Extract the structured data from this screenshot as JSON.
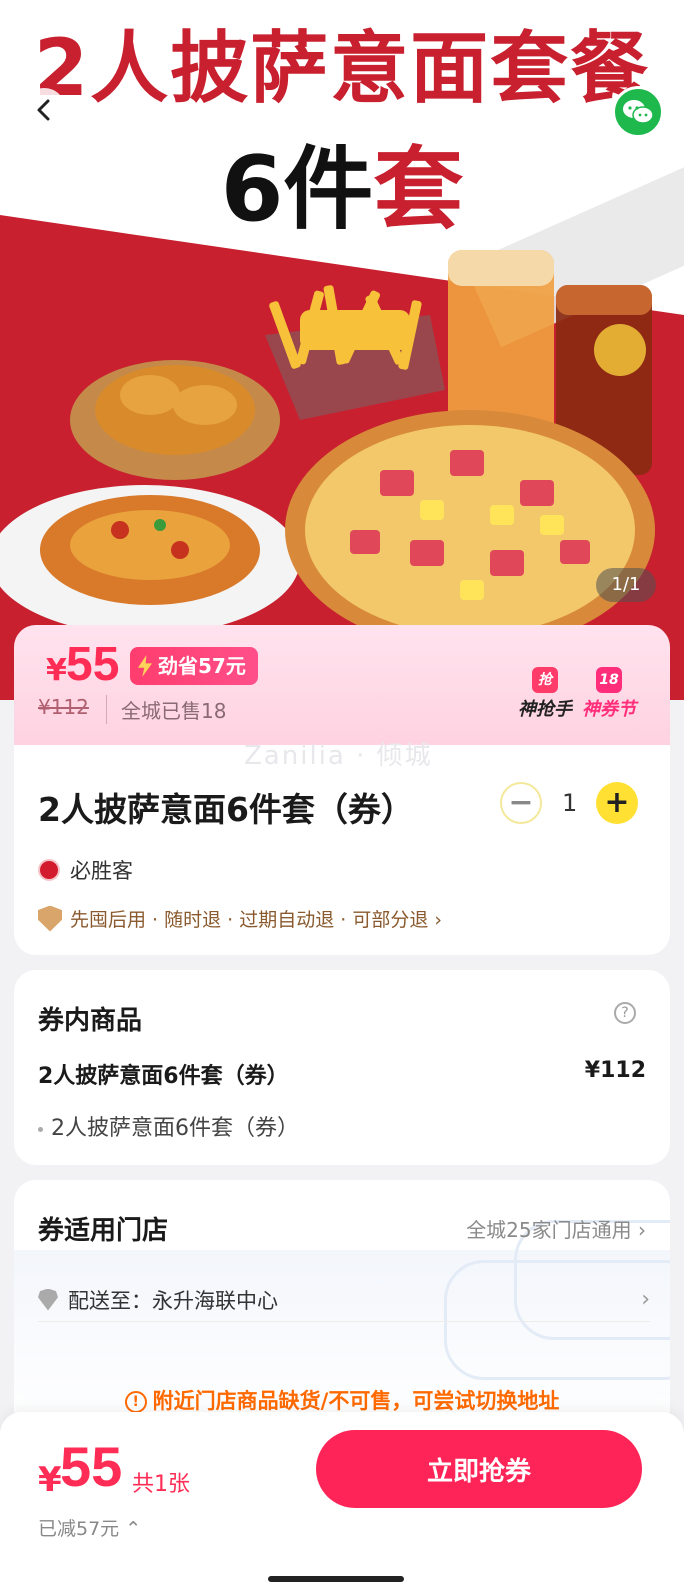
{
  "hero": {
    "title_line1": "2人披萨意面套餐",
    "title_line2_a": "6件",
    "title_line2_b": "套",
    "image_counter": "1/1",
    "colors": {
      "brand_red": "#c8202f"
    }
  },
  "nav": {
    "back_icon": "chevron-left-icon",
    "share_icon": "wechat-icon"
  },
  "price_card": {
    "currency": "¥",
    "price": "55",
    "save_badge": "劲省57元",
    "original_price": "¥112",
    "sold": "全城已售18",
    "promo_1": "神抢手",
    "promo_1_icon": "抢",
    "promo_2": "神券节",
    "promo_2_icon": "18",
    "colors": {
      "accent": "#ff2d55"
    }
  },
  "product": {
    "watermark": "Zanilia · 倾城",
    "title": "2人披萨意面6件套（券）",
    "quantity": "1",
    "minus_label": "−",
    "plus_label": "+",
    "brand": "必胜客",
    "guarantee": "先囤后用 · 随时退 · 过期自动退 · 可部分退 ›"
  },
  "voucher_content": {
    "title": "券内商品",
    "help": "?",
    "item_name": "2人披萨意面6件套（券）",
    "item_price": "¥112",
    "item_sub": "2人披萨意面6件套（券）"
  },
  "stores": {
    "title": "券适用门店",
    "link": "全城25家门店通用 ›",
    "deliver_label": "配送至：永升海联中心",
    "deliver_chevron": "›",
    "warning": "附近门店商品缺货/不可售，可尝试切换地址",
    "warning_icon": "!"
  },
  "bottom_bar": {
    "currency": "¥",
    "price": "55",
    "count": "共1张",
    "saved": "已减57元 ⌃",
    "buy_label": "立即抢券"
  }
}
